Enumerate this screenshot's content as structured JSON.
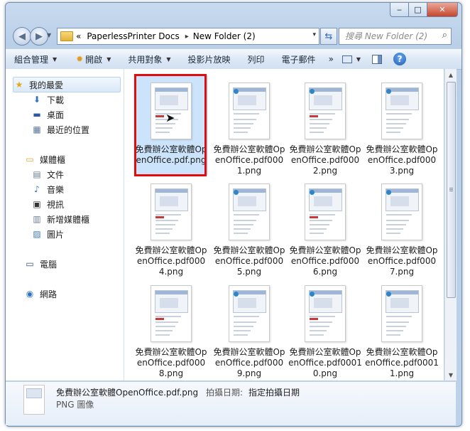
{
  "window": {
    "controls": {
      "minimize": "‒",
      "maximize": "□",
      "close": "✕"
    }
  },
  "address": {
    "prefix": "«",
    "crumbs": [
      "PaperlessPrinter Docs",
      "New Folder (2)"
    ],
    "separator": "▸",
    "dropdown": "▾"
  },
  "search": {
    "placeholder": "搜尋 New Folder (2)"
  },
  "toolbar": {
    "organize": "組合管理",
    "open": "開啟",
    "share": "共用對象",
    "slideshow": "投影片放映",
    "print": "列印",
    "email": "電子郵件",
    "more": "»",
    "help": "?"
  },
  "sidebar": {
    "favorites": {
      "label": "我的最愛",
      "icon": "star-icon"
    },
    "favorite_items": [
      {
        "label": "下載",
        "icon": "downloads-icon"
      },
      {
        "label": "桌面",
        "icon": "desktop-icon"
      },
      {
        "label": "最近的位置",
        "icon": "recent-places-icon"
      }
    ],
    "libraries": {
      "label": "媒體櫃",
      "icon": "library-icon"
    },
    "library_items": [
      {
        "label": "文件",
        "icon": "documents-icon"
      },
      {
        "label": "音樂",
        "icon": "music-icon"
      },
      {
        "label": "視訊",
        "icon": "video-icon"
      },
      {
        "label": "新增媒體櫃",
        "icon": "new-library-icon"
      },
      {
        "label": "圖片",
        "icon": "pictures-icon"
      }
    ],
    "computer": {
      "label": "電腦",
      "icon": "computer-icon"
    },
    "network": {
      "label": "網路",
      "icon": "network-icon"
    }
  },
  "files": [
    {
      "name": "免費辦公室軟體OpenOffice.pdf.png",
      "selected": true
    },
    {
      "name": "免費辦公室軟體OpenOffice.pdf0001.png"
    },
    {
      "name": "免費辦公室軟體OpenOffice.pdf0002.png"
    },
    {
      "name": "免費辦公室軟體OpenOffice.pdf0003.png"
    },
    {
      "name": "免費辦公室軟體OpenOffice.pdf0004.png"
    },
    {
      "name": "免費辦公室軟體OpenOffice.pdf0005.png"
    },
    {
      "name": "免費辦公室軟體OpenOffice.pdf0006.png"
    },
    {
      "name": "免費辦公室軟體OpenOffice.pdf0007.png"
    },
    {
      "name": "免費辦公室軟體OpenOffice.pdf0008.png"
    },
    {
      "name": "免費辦公室軟體OpenOffice.pdf0009.png"
    },
    {
      "name": "免費辦公室軟體OpenOffice.pdf00010.png"
    },
    {
      "name": "免費辦公室軟體OpenOffice.pdf00011.png"
    }
  ],
  "details": {
    "filename": "免費辦公室軟體OpenOffice.pdf.png",
    "date_label": "拍攝日期:",
    "date_value": "指定拍攝日期",
    "type": "PNG 圖像"
  },
  "colors": {
    "highlight_border": "#e10d0d",
    "selection": "#cce4fb",
    "accent": "#1d5fb5"
  }
}
